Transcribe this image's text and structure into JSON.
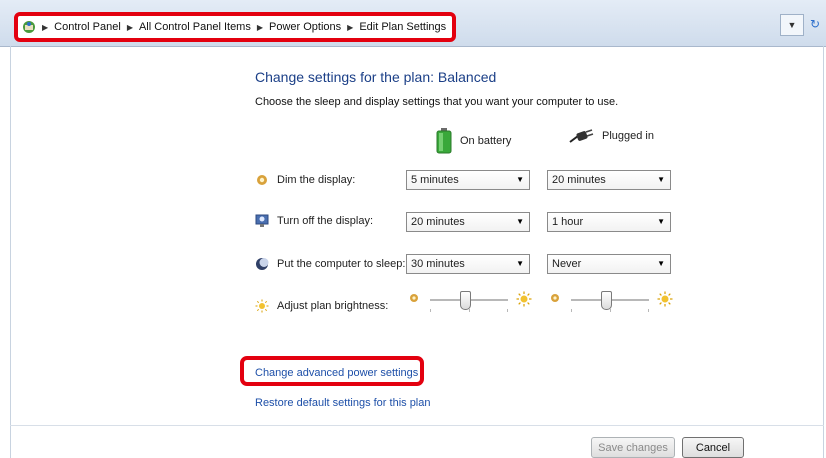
{
  "breadcrumb": [
    "Control Panel",
    "All Control Panel Items",
    "Power Options",
    "Edit Plan Settings"
  ],
  "page": {
    "title": "Change settings for the plan: Balanced",
    "subtitle": "Choose the sleep and display settings that you want your computer to use."
  },
  "columns": {
    "battery": "On battery",
    "plugged": "Plugged in"
  },
  "rows": [
    {
      "label": "Dim the display:",
      "battery": "5 minutes",
      "plugged": "20 minutes"
    },
    {
      "label": "Turn off the display:",
      "battery": "20 minutes",
      "plugged": "1 hour"
    },
    {
      "label": "Put the computer to sleep:",
      "battery": "30 minutes",
      "plugged": "Never"
    }
  ],
  "brightness": {
    "label": "Adjust plan brightness:",
    "battery_level": 0.45,
    "plugged_level": 0.45
  },
  "links": {
    "advanced": "Change advanced power settings",
    "restore": "Restore default settings for this plan"
  },
  "buttons": {
    "save": "Save changes",
    "cancel": "Cancel"
  },
  "colors": {
    "highlight": "#e3000f",
    "title": "#1b3f87",
    "link": "#1d4fa8"
  },
  "icons": {
    "home": "control-panel-icon",
    "battery": "battery-icon",
    "plug": "power-plug-icon",
    "dim": "dim-display-icon",
    "monitor": "monitor-off-icon",
    "sleep": "sleep-moon-icon",
    "brightness": "sun-icon"
  }
}
